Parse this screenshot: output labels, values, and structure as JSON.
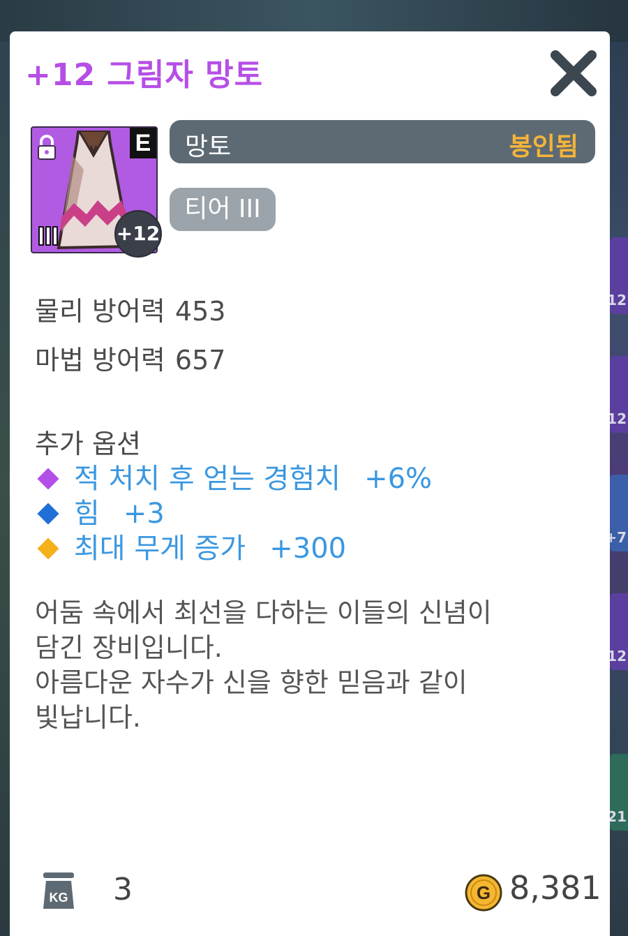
{
  "item": {
    "title": "+12 그림자 망토",
    "type": "망토",
    "status": "봉인됨",
    "tier": "티어 III",
    "grade": "E",
    "enhance": "+12",
    "icon": "shadow-cloak-icon"
  },
  "stats": [
    {
      "label": "물리 방어력",
      "value": "453"
    },
    {
      "label": "마법 방어력",
      "value": "657"
    }
  ],
  "options": {
    "title": "추가 옵션",
    "items": [
      {
        "name": "적 처치 후 얻는 경험치",
        "value": "+6%",
        "color": "#b34ee8"
      },
      {
        "name": "힘",
        "value": "+3",
        "color": "#1f6fd6"
      },
      {
        "name": "최대 무게 증가",
        "value": "+300",
        "color": "#f5b11a"
      }
    ]
  },
  "description": [
    "어둠 속에서 최선을 다하는 이들의 신념이",
    "담긴 장비입니다.",
    "아름다운 자수가 신을 향한 믿음과 같이",
    "빛납니다."
  ],
  "footer": {
    "weight_icon": "KG",
    "weight": "3",
    "gold_icon": "G",
    "price": "8,381"
  },
  "background_slots": [
    "12",
    "12",
    "+7",
    "12",
    "21"
  ],
  "colors": {
    "title": "#b64ee6",
    "option_text": "#3a97e0",
    "bound": "#f5b43a",
    "type_pill": "#5e6a73",
    "tier_pill": "#9ba4aa",
    "icon_bg": "#b15be3"
  }
}
